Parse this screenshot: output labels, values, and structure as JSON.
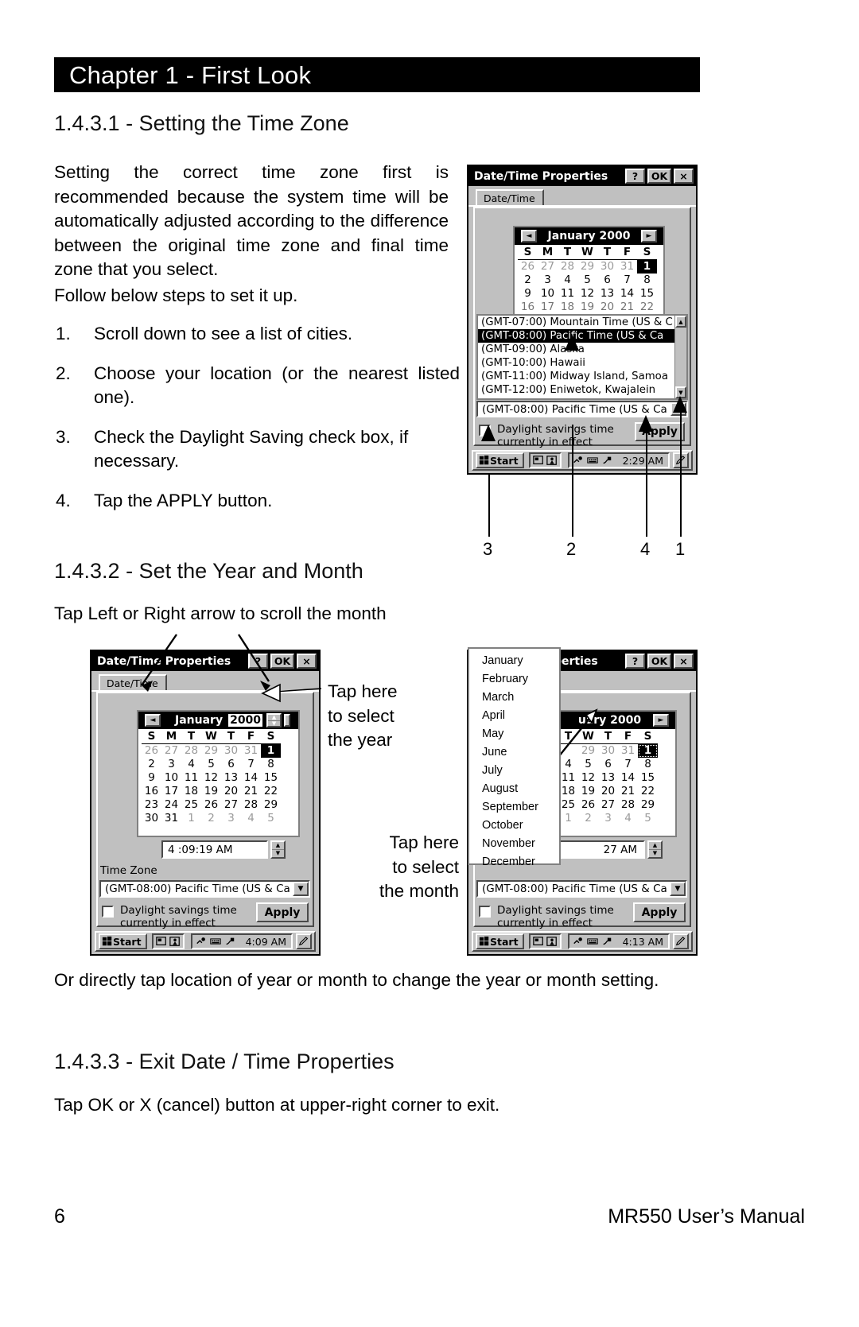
{
  "page": {
    "chapter_banner": "Chapter 1 - First Look",
    "footer_page_number": "6",
    "footer_title": "MR550 User’s Manual"
  },
  "sections": {
    "s1": {
      "heading": "1.4.3.1 - Setting the Time Zone",
      "intro": "Setting the correct time zone first is recommended because the system time will be automatically adjusted according to the difference between the original time zone and final time zone that you select.",
      "intro_line2": "Follow below steps to set it up.",
      "steps": [
        {
          "num": "1.",
          "text": "Scroll down to see a list of cities."
        },
        {
          "num": "2.",
          "text": "Choose your location (or the nearest listed one)."
        },
        {
          "num": "3.",
          "text": "Check the Daylight Saving check box, if necessary."
        },
        {
          "num": "4.",
          "text": "Tap the APPLY button."
        }
      ],
      "callout_numbers": [
        "3",
        "2",
        "4",
        "1"
      ]
    },
    "s2": {
      "heading": "1.4.3.2 - Set the Year and Month",
      "intro": "Tap Left or Right arrow to scroll the month",
      "annotation_year": "Tap here\nto select\nthe year",
      "annotation_year_lines": [
        "Tap here",
        "to select",
        "the year"
      ],
      "annotation_month_lines": [
        "Tap here",
        "to select",
        "the month"
      ],
      "outro": "Or directly tap location of year or month to change the year or month setting."
    },
    "s3": {
      "heading": "1.4.3.3 - Exit Date / Time Properties",
      "body": "Tap OK or X (cancel) button at upper-right corner to exit."
    }
  },
  "screenshot_1": {
    "title": "Date/Time Properties",
    "title_buttons": [
      "?",
      "OK",
      "×"
    ],
    "tab": "Date/Time",
    "calendar": {
      "month_year": "January 2000",
      "prev_arrow": "◄",
      "next_arrow": "►",
      "dow": [
        "S",
        "M",
        "T",
        "W",
        "T",
        "F",
        "S"
      ],
      "weeks": [
        [
          {
            "d": "26",
            "t": "muted"
          },
          {
            "d": "27",
            "t": "muted"
          },
          {
            "d": "28",
            "t": "muted"
          },
          {
            "d": "29",
            "t": "muted"
          },
          {
            "d": "30",
            "t": "muted"
          },
          {
            "d": "31",
            "t": "muted"
          },
          {
            "d": "1",
            "t": "sel"
          }
        ],
        [
          {
            "d": "2",
            "t": ""
          },
          {
            "d": "3",
            "t": ""
          },
          {
            "d": "4",
            "t": ""
          },
          {
            "d": "5",
            "t": ""
          },
          {
            "d": "6",
            "t": ""
          },
          {
            "d": "7",
            "t": ""
          },
          {
            "d": "8",
            "t": ""
          }
        ],
        [
          {
            "d": "9",
            "t": ""
          },
          {
            "d": "10",
            "t": ""
          },
          {
            "d": "11",
            "t": ""
          },
          {
            "d": "12",
            "t": ""
          },
          {
            "d": "13",
            "t": ""
          },
          {
            "d": "14",
            "t": ""
          },
          {
            "d": "15",
            "t": ""
          }
        ],
        [
          {
            "d": "16",
            "t": ""
          },
          {
            "d": "17",
            "t": ""
          },
          {
            "d": "18",
            "t": ""
          },
          {
            "d": "19",
            "t": ""
          },
          {
            "d": "20",
            "t": ""
          },
          {
            "d": "21",
            "t": ""
          },
          {
            "d": "22",
            "t": ""
          }
        ]
      ]
    },
    "timezone_list": [
      {
        "label": "(GMT-07:00) Mountain Time (US & C",
        "selected": false
      },
      {
        "label": "(GMT-08:00) Pacific Time (US & Ca",
        "selected": true
      },
      {
        "label": "(GMT-09:00) Alaska",
        "selected": false
      },
      {
        "label": "(GMT-10:00) Hawaii",
        "selected": false
      },
      {
        "label": "(GMT-11:00) Midway Island, Samoa",
        "selected": false
      },
      {
        "label": "(GMT-12:00) Eniwetok, Kwajalein",
        "selected": false
      }
    ],
    "timezone_value": "(GMT-08:00) Pacific Time (US & Ca",
    "daylight_label_line1": "Daylight savings time",
    "daylight_label_line2": "currently in effect",
    "apply_label": "Apply",
    "taskbar": {
      "start": "Start",
      "clock": "2:29 AM"
    }
  },
  "screenshot_2": {
    "title": "Date/Time Properties",
    "title_buttons": [
      "?",
      "OK",
      "×"
    ],
    "tab": "Date/Time",
    "calendar": {
      "month": "January",
      "year": "2000",
      "prev_arrow": "◄",
      "dow": [
        "S",
        "M",
        "T",
        "W",
        "T",
        "F",
        "S"
      ],
      "weeks": [
        [
          {
            "d": "26",
            "t": "muted"
          },
          {
            "d": "27",
            "t": "muted"
          },
          {
            "d": "28",
            "t": "muted"
          },
          {
            "d": "29",
            "t": "muted"
          },
          {
            "d": "30",
            "t": "muted"
          },
          {
            "d": "31",
            "t": "muted"
          },
          {
            "d": "1",
            "t": "sel"
          }
        ],
        [
          {
            "d": "2",
            "t": ""
          },
          {
            "d": "3",
            "t": ""
          },
          {
            "d": "4",
            "t": ""
          },
          {
            "d": "5",
            "t": ""
          },
          {
            "d": "6",
            "t": ""
          },
          {
            "d": "7",
            "t": ""
          },
          {
            "d": "8",
            "t": ""
          }
        ],
        [
          {
            "d": "9",
            "t": ""
          },
          {
            "d": "10",
            "t": ""
          },
          {
            "d": "11",
            "t": ""
          },
          {
            "d": "12",
            "t": ""
          },
          {
            "d": "13",
            "t": ""
          },
          {
            "d": "14",
            "t": ""
          },
          {
            "d": "15",
            "t": ""
          }
        ],
        [
          {
            "d": "16",
            "t": ""
          },
          {
            "d": "17",
            "t": ""
          },
          {
            "d": "18",
            "t": ""
          },
          {
            "d": "19",
            "t": ""
          },
          {
            "d": "20",
            "t": ""
          },
          {
            "d": "21",
            "t": ""
          },
          {
            "d": "22",
            "t": ""
          }
        ],
        [
          {
            "d": "23",
            "t": ""
          },
          {
            "d": "24",
            "t": ""
          },
          {
            "d": "25",
            "t": ""
          },
          {
            "d": "26",
            "t": ""
          },
          {
            "d": "27",
            "t": ""
          },
          {
            "d": "28",
            "t": ""
          },
          {
            "d": "29",
            "t": ""
          }
        ],
        [
          {
            "d": "30",
            "t": ""
          },
          {
            "d": "31",
            "t": ""
          },
          {
            "d": "1",
            "t": "muted"
          },
          {
            "d": "2",
            "t": "muted"
          },
          {
            "d": "3",
            "t": "muted"
          },
          {
            "d": "4",
            "t": "muted"
          },
          {
            "d": "5",
            "t": "muted"
          }
        ]
      ]
    },
    "time_value": "4 :09:19 AM",
    "timezone_label": "Time Zone",
    "timezone_value": "(GMT-08:00) Pacific Time (US & Ca",
    "daylight_label_line1": "Daylight savings time",
    "daylight_label_line2": "currently in effect",
    "apply_label": "Apply",
    "taskbar": {
      "start": "Start",
      "clock": "4:09 AM"
    }
  },
  "screenshot_3": {
    "title_fragment": "perties",
    "title_buttons": [
      "?",
      "OK",
      "×"
    ],
    "calendar": {
      "month_year_fragment": "uary 2000",
      "next_arrow": "►",
      "dow": [
        "T",
        "W",
        "T",
        "F",
        "S"
      ],
      "weeks": [
        [
          {
            "d": "29",
            "t": "muted"
          },
          {
            "d": "30",
            "t": "muted"
          },
          {
            "d": "31",
            "t": "muted"
          },
          {
            "d": "1",
            "t": "sel"
          }
        ],
        [
          {
            "d": "4",
            "t": ""
          },
          {
            "d": "5",
            "t": ""
          },
          {
            "d": "6",
            "t": ""
          },
          {
            "d": "7",
            "t": ""
          },
          {
            "d": "8",
            "t": ""
          }
        ],
        [
          {
            "d": "11",
            "t": ""
          },
          {
            "d": "12",
            "t": ""
          },
          {
            "d": "13",
            "t": ""
          },
          {
            "d": "14",
            "t": ""
          },
          {
            "d": "15",
            "t": ""
          }
        ],
        [
          {
            "d": "18",
            "t": ""
          },
          {
            "d": "19",
            "t": ""
          },
          {
            "d": "20",
            "t": ""
          },
          {
            "d": "21",
            "t": ""
          },
          {
            "d": "22",
            "t": ""
          }
        ],
        [
          {
            "d": "25",
            "t": ""
          },
          {
            "d": "26",
            "t": ""
          },
          {
            "d": "27",
            "t": ""
          },
          {
            "d": "28",
            "t": ""
          },
          {
            "d": "29",
            "t": ""
          }
        ],
        [
          {
            "d": "1",
            "t": "muted"
          },
          {
            "d": "2",
            "t": "muted"
          },
          {
            "d": "3",
            "t": "muted"
          },
          {
            "d": "4",
            "t": "muted"
          },
          {
            "d": "5",
            "t": "muted"
          }
        ]
      ]
    },
    "month_dropdown": [
      "January",
      "February",
      "March",
      "April",
      "May",
      "June",
      "July",
      "August",
      "September",
      "October",
      "November",
      "December"
    ],
    "time_value_fragment": "27 AM",
    "timezone_value": "(GMT-08:00) Pacific Time (US & Ca",
    "daylight_label_line1": "Daylight savings time",
    "daylight_label_line2": "currently in effect",
    "apply_label": "Apply",
    "taskbar": {
      "start": "Start",
      "clock": "4:13 AM"
    }
  }
}
